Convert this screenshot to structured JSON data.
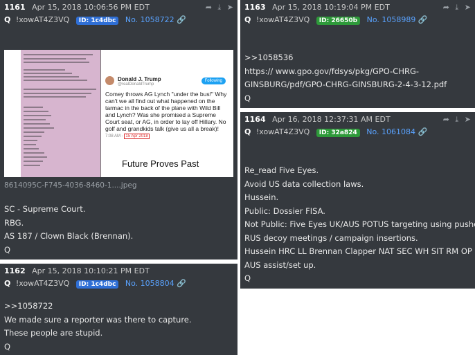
{
  "posts": [
    {
      "number": "1161",
      "date": "Apr 15, 2018 10:06:56 PM EDT",
      "q": "Q",
      "trip": "!xowAT4Z3VQ",
      "id_badge": "ID: 1c4dbc",
      "badge_color": "#2f6fd6",
      "post_no": "No. 1058722",
      "image_filename": "8614095C-F745-4036-8460-1....jpeg",
      "image": {
        "tweet_name": "Donald J. Trump",
        "tweet_handle": "@realDonaldTrump",
        "follow_label": "Following",
        "tweet_text": "Comey throws AG Lynch \"under the bus!\" Why can't we all find out what happened on the tarmac in the back of the plane with Wild Bill and Lynch? Was she promised a Supreme Court seat, or AG, in order to lay off Hillary. No golf and grandkids talk (give us all a break)!",
        "tweet_time": "7:08 AM",
        "tweet_date": "15 Apr 2018",
        "caption": "Future Proves Past"
      },
      "body": [
        "SC - Supreme Court.",
        "RBG.",
        "AS 187 / Clown Black (Brennan).",
        "Q"
      ]
    },
    {
      "number": "1162",
      "date": "Apr 15, 2018 10:10:21 PM EDT",
      "q": "Q",
      "trip": "!xowAT4Z3VQ",
      "id_badge": "ID: 1c4dbc",
      "badge_color": "#2f6fd6",
      "post_no": "No. 1058804",
      "body": [
        ">>1058722",
        "We made sure a reporter was there to capture.",
        "These people are stupid.",
        "Q"
      ]
    },
    {
      "number": "1163",
      "date": "Apr 15, 2018 10:19:04 PM EDT",
      "q": "Q",
      "trip": "!xowAT4Z3VQ",
      "id_badge": "ID: 26650b",
      "badge_color": "#2e9a3a",
      "post_no": "No. 1058989",
      "body": [
        ">>1058536",
        "https:// www.gpo.gov/fdsys/pkg/GPO-CHRG-",
        "GINSBURG/pdf/GPO-CHRG-GINSBURG-2-4-3-12.pdf",
        "Q"
      ]
    },
    {
      "number": "1164",
      "date": "Apr 16, 2018 12:37:31 AM EDT",
      "q": "Q",
      "trip": "!xowAT4Z3VQ",
      "id_badge": "ID: 32a824",
      "badge_color": "#2e9a3a",
      "post_no": "No. 1061084",
      "body": [
        "Re_read Five Eyes.",
        "Avoid US data collection laws.",
        "Hussein.",
        "Public: Dossier FISA.",
        "Not Public: Five Eyes UK/AUS POTUS targeting using pushed",
        "RUS decoy meetings / campaign insertions.",
        "Hussein HRC LL Brennan Clapper NAT SEC WH SIT RM OP UK",
        "AUS assist/set up.",
        "Q"
      ]
    }
  ],
  "icons": [
    "share-icon",
    "download-icon",
    "go-arrow-icon"
  ]
}
